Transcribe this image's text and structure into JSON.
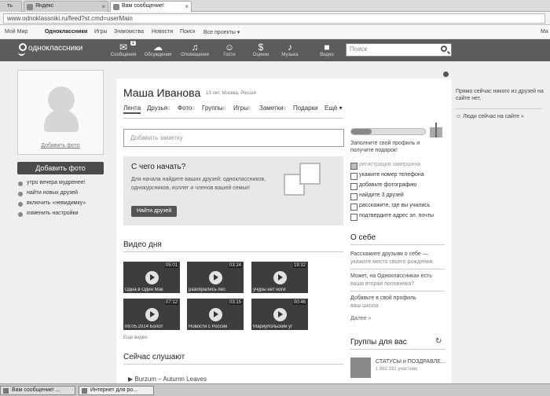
{
  "browser": {
    "tabs": [
      "ть",
      "Яндекс",
      "Вам сообщение!"
    ],
    "url": "www.odnoklassniki.ru/feed?st.cmd=userMain"
  },
  "toplinks": [
    "Мой Мир",
    "Одноклассники",
    "Игры",
    "Знакомства",
    "Новости",
    "Поиск",
    "Все проекты ▾",
    "Ма"
  ],
  "nav": {
    "logo": "одноклассники",
    "items": [
      {
        "glyph": "✉",
        "label": "Сообщения",
        "badge": "1"
      },
      {
        "glyph": "☁",
        "label": "Обсуждения"
      },
      {
        "glyph": "♫",
        "label": "Оповещения"
      },
      {
        "glyph": "☺",
        "label": "Гости"
      },
      {
        "glyph": "$",
        "label": "Оценки"
      },
      {
        "glyph": "♪",
        "label": "Музыка"
      },
      {
        "glyph": "■",
        "label": "Видео"
      }
    ],
    "search_placeholder": "Поиск"
  },
  "profile": {
    "add_photo_caption": "Добавить фото",
    "add_photo_button": "Добавить фото",
    "menu": [
      "утро вечера мудренее!",
      "найти новых друзей",
      "включить «невидимку»",
      "изменить настройки"
    ],
    "name": "Маша Иванова",
    "location": "13 лет, Москва, Россия",
    "tabs": [
      {
        "label": "Лента",
        "count": ""
      },
      {
        "label": "Друзья",
        "count": "0"
      },
      {
        "label": "Фото",
        "count": "0"
      },
      {
        "label": "Группы",
        "count": "0"
      },
      {
        "label": "Игры",
        "count": "0"
      },
      {
        "label": "Заметки",
        "count": "0"
      },
      {
        "label": "Подарки",
        "count": ""
      },
      {
        "label": "Ещё ▾",
        "count": ""
      }
    ],
    "note_placeholder": "Добавить заметку"
  },
  "start": {
    "title": "С чего начать?",
    "text": "Для начала найдите ваших друзей: одноклассников, однокурсников, коллег и членов вашей семьи!",
    "button": "Найти друзей"
  },
  "videos": {
    "title": "Видео дня",
    "items": [
      {
        "duration": "05:01",
        "caption": "Одна в Один Мак"
      },
      {
        "duration": "03:24",
        "caption": "разобрались пес"
      },
      {
        "duration": "19:32",
        "caption": "учуры нет ноги"
      },
      {
        "duration": "07:12",
        "caption": "09.05.2014 Болот"
      },
      {
        "duration": "03:15",
        "caption": "Новости с Россий"
      },
      {
        "duration": "00:46",
        "caption": "Мариупольский уг"
      }
    ],
    "more": "Еще видео"
  },
  "listening": {
    "title": "Сейчас слушают",
    "track": "Burzum – Autumn Leaves"
  },
  "completion": {
    "progress": 0.28,
    "prompt": "Заполните свой профиль и получите подарок!",
    "steps": [
      {
        "label": "регистрация завершена",
        "done": true
      },
      {
        "label": "укажите номер телефона",
        "done": false
      },
      {
        "label": "добавьте фотографию",
        "done": false
      },
      {
        "label": "найдите 3 друзей",
        "done": false
      },
      {
        "label": "расскажите, где вы учились",
        "done": false
      },
      {
        "label": "подтвердите адрес эл. почты",
        "done": false
      }
    ]
  },
  "about": {
    "title": "О себе",
    "items": [
      {
        "title": "Расскажите друзьям о себе —",
        "sub": "укажите место своего рождения."
      },
      {
        "title": "Может, на Одноклассниках есть",
        "sub": "ваша вторая половинка?"
      },
      {
        "title": "Добавьте в свой профиль",
        "sub": "ваш школа"
      }
    ],
    "more": "Далее »"
  },
  "groups": {
    "title": "Группы для вас",
    "item_name": "СТАТУСЫ и ПОЗДРАВЛЕ...",
    "item_count": "1 862 331 участник"
  },
  "online": {
    "text": "Прямо сейчас никого из друзей на сайте нет.",
    "link": "Люди сейчас на сайте »"
  },
  "taskbar": [
    "Вам сообщение! ...",
    "Интернет для ро..."
  ]
}
